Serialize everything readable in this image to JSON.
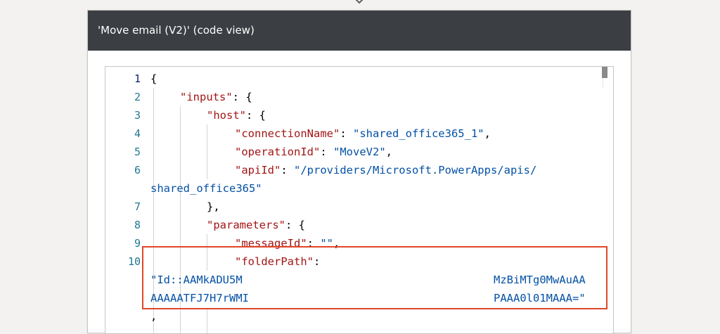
{
  "header": {
    "title": "'Move email (V2)' (code view)"
  },
  "editor": {
    "line_numbers": [
      "1",
      "2",
      "3",
      "4",
      "5",
      "6",
      "7",
      "8",
      "9",
      "10"
    ],
    "lines": {
      "l1": {
        "text": "{"
      },
      "l2": {
        "key": "\"inputs\"",
        "rest": ": {"
      },
      "l3": {
        "key": "\"host\"",
        "rest": ": {"
      },
      "l4": {
        "key": "\"connectionName\"",
        "sep": ": ",
        "value": "\"shared_office365_1\"",
        "tail": ","
      },
      "l5": {
        "key": "\"operationId\"",
        "sep": ": ",
        "value": "\"MoveV2\"",
        "tail": ","
      },
      "l6": {
        "key": "\"apiId\"",
        "sep": ": ",
        "value": "\"/providers/Microsoft.PowerApps/apis/"
      },
      "l6b": {
        "value": "shared_office365\""
      },
      "l7": {
        "text": "},"
      },
      "l8": {
        "key": "\"parameters\"",
        "rest": ": {"
      },
      "l9": {
        "key": "\"messageId\"",
        "sep": ": ",
        "value": "\"\"",
        "tail": ","
      },
      "l10": {
        "key": "\"folderPath\"",
        "rest": ":"
      },
      "l10b_left": "\"Id::AAMkADU5M",
      "l10b_right": "MzBiMTg0MwAuAA",
      "l10c_left": "AAAAATFJ7H7rWMI",
      "l10c_right": "PAAA0l01MAAA=\"",
      "l11": {
        "text": ","
      }
    }
  },
  "colors": {
    "header_bg": "#3b3e42",
    "key": "#a31515",
    "string": "#0451a5",
    "line_number": "#237893",
    "highlight_border": "#e0462a"
  }
}
